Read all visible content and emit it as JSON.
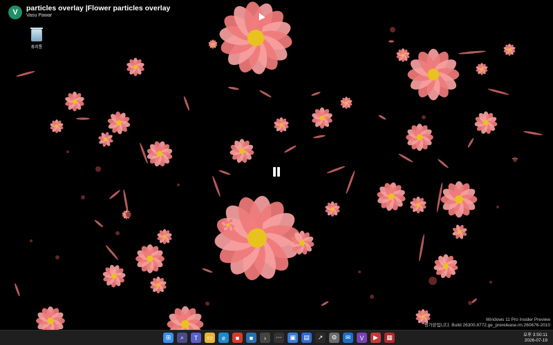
{
  "video": {
    "title": "particles overlay |Flower particles overlay",
    "channel": "Vasu Pawar",
    "avatar_letter": "V"
  },
  "desktop": {
    "recycle_bin_label": "휴지통"
  },
  "watermark": {
    "line1": "Windows 11 Pro Insider Preview",
    "line2": "평가본입니다. Build 26300.8772.ge_prerelease.im.260676-2010"
  },
  "clock": {
    "time": "오후 3:50:11",
    "date": "2026-07-19"
  },
  "taskbar_icons": [
    {
      "name": "start-icon",
      "color": "#3a8ee6",
      "glyph": "⊞"
    },
    {
      "name": "search-icon",
      "color": "#4a4a8a",
      "glyph": "⌕"
    },
    {
      "name": "teams-icon",
      "color": "#5b5fc7",
      "glyph": "T"
    },
    {
      "name": "file-explorer-icon",
      "color": "#e7b53a",
      "glyph": "▭"
    },
    {
      "name": "edge-icon",
      "color": "#1e88c9",
      "glyph": "e"
    },
    {
      "name": "app-red-icon",
      "color": "#d33a2c",
      "glyph": "■"
    },
    {
      "name": "app-blue-icon",
      "color": "#2a6fb0",
      "glyph": "■"
    },
    {
      "name": "terminal-icon",
      "color": "#444444",
      "glyph": "›"
    },
    {
      "name": "dots-icon",
      "color": "#333333",
      "glyph": "⋯"
    },
    {
      "name": "photos-icon",
      "color": "#3b7bd8",
      "glyph": "▣"
    },
    {
      "name": "store-icon",
      "color": "#2f6bd1",
      "glyph": "▤"
    },
    {
      "name": "stocks-icon",
      "color": "#2a2a2a",
      "glyph": "↗"
    },
    {
      "name": "settings-icon",
      "color": "#6b6b6b",
      "glyph": "⚙"
    },
    {
      "name": "mail-icon",
      "color": "#1d6fc2",
      "glyph": "✉"
    },
    {
      "name": "visual-studio-icon",
      "color": "#7a3fb8",
      "glyph": "V"
    },
    {
      "name": "media-icon",
      "color": "#c23a3a",
      "glyph": "▶"
    },
    {
      "name": "app-white-icon",
      "color": "#b02a2a",
      "glyph": "▦"
    }
  ],
  "colors": {
    "petal": "#f07a7a",
    "petal_light": "#f6a0a0",
    "center": "#e8c21e",
    "background": "#000000"
  }
}
